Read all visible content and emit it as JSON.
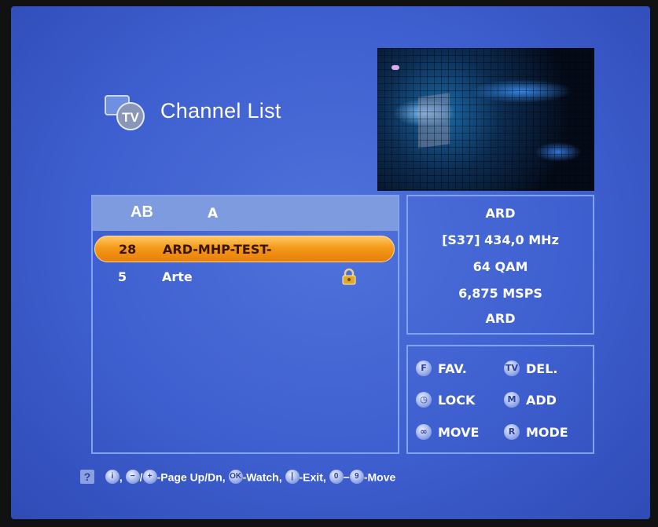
{
  "header": {
    "title": "Channel List",
    "icon_text": "TV"
  },
  "list": {
    "header_icon": "AB",
    "header_letter": "A",
    "channels": [
      {
        "number": "28",
        "name": "ARD-MHP-TEST-",
        "selected": true,
        "locked": false
      },
      {
        "number": "5",
        "name": "Arte",
        "selected": false,
        "locked": true
      }
    ]
  },
  "info": {
    "lines": [
      "ARD",
      "[S37]  434,0 MHz",
      "64 QAM",
      "6,875 MSPS",
      "ARD"
    ]
  },
  "keys": [
    {
      "badge": "F",
      "label": "FAV."
    },
    {
      "badge": "TV",
      "label": "DEL."
    },
    {
      "badge": "◷",
      "label": "LOCK"
    },
    {
      "badge": "M",
      "label": "ADD"
    },
    {
      "badge": "∞",
      "label": "MOVE"
    },
    {
      "badge": "R",
      "label": "MODE"
    }
  ],
  "help": {
    "q": "?",
    "b_i": "i",
    "sep1": ",",
    "b_minus": "−",
    "sep2": "/",
    "b_plus": "+",
    "page": "-Page Up/Dn,",
    "b_ok": "OK",
    "watch": "-Watch,",
    "b_exit": "❘",
    "exit": "-Exit,",
    "b_0": "0",
    "dash": "−",
    "b_9": "9",
    "move": "-Move"
  },
  "colors": {
    "accent": "#f49a18",
    "background": "#3e5fcf",
    "border": "#7fa3ef"
  }
}
